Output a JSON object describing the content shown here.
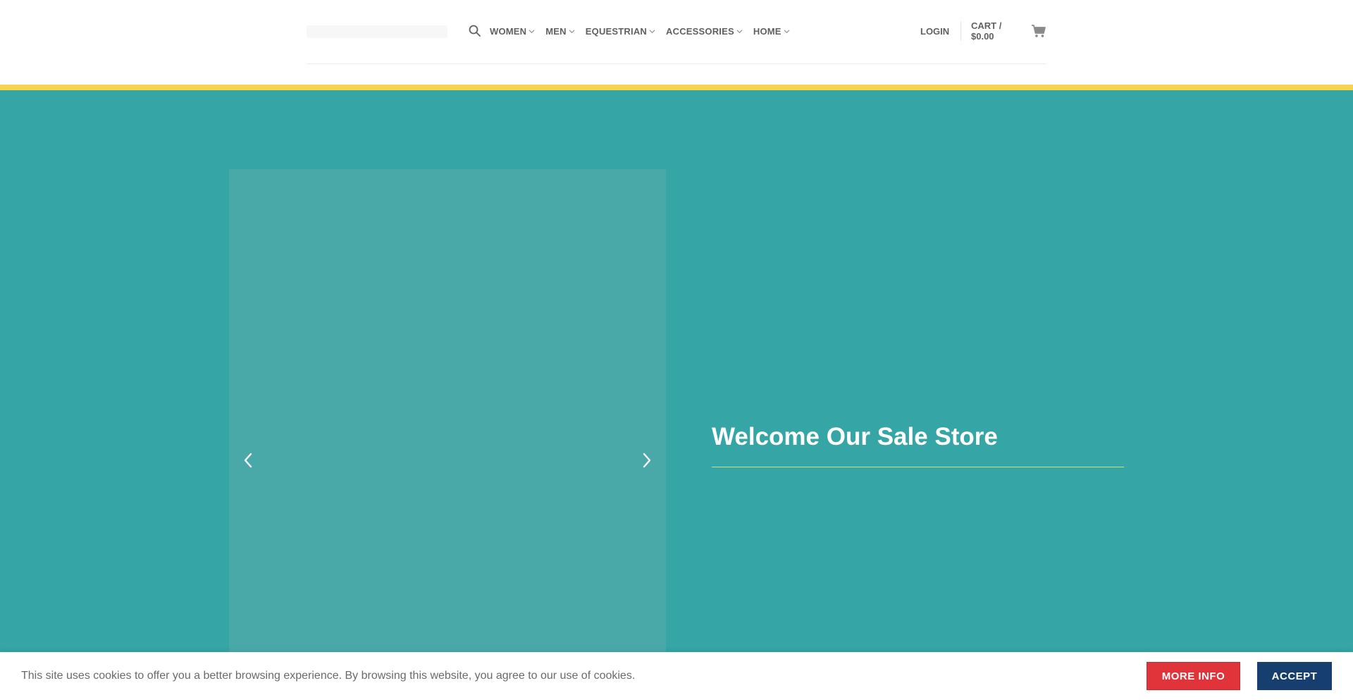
{
  "header": {
    "nav": [
      {
        "label": "WOMEN"
      },
      {
        "label": "MEN"
      },
      {
        "label": "EQUESTRIAN"
      },
      {
        "label": "ACCESSORIES"
      },
      {
        "label": "HOME"
      }
    ],
    "login_label": "LOGIN",
    "cart_label": "CART / $0.00",
    "icons": {
      "search": "search-icon",
      "cart": "shopping-cart-icon",
      "dropdown": "chevron-down-icon"
    }
  },
  "hero": {
    "title": "Welcome Our Sale Store",
    "icons": {
      "prev": "chevron-left-icon",
      "next": "chevron-right-icon"
    }
  },
  "cookie_notice": {
    "text": "This site uses cookies to offer you a better browsing experience. By browsing this website, you agree to our use of cookies.",
    "more_info_label": "MORE INFO",
    "accept_label": "ACCEPT"
  },
  "colors": {
    "accent_bar": "#f6d44e",
    "hero_background": "#36a5a5",
    "slider_background": "#49a9a9",
    "more_info_button": "#e0343a",
    "accept_button": "#163f70",
    "nav_text": "#606060"
  }
}
